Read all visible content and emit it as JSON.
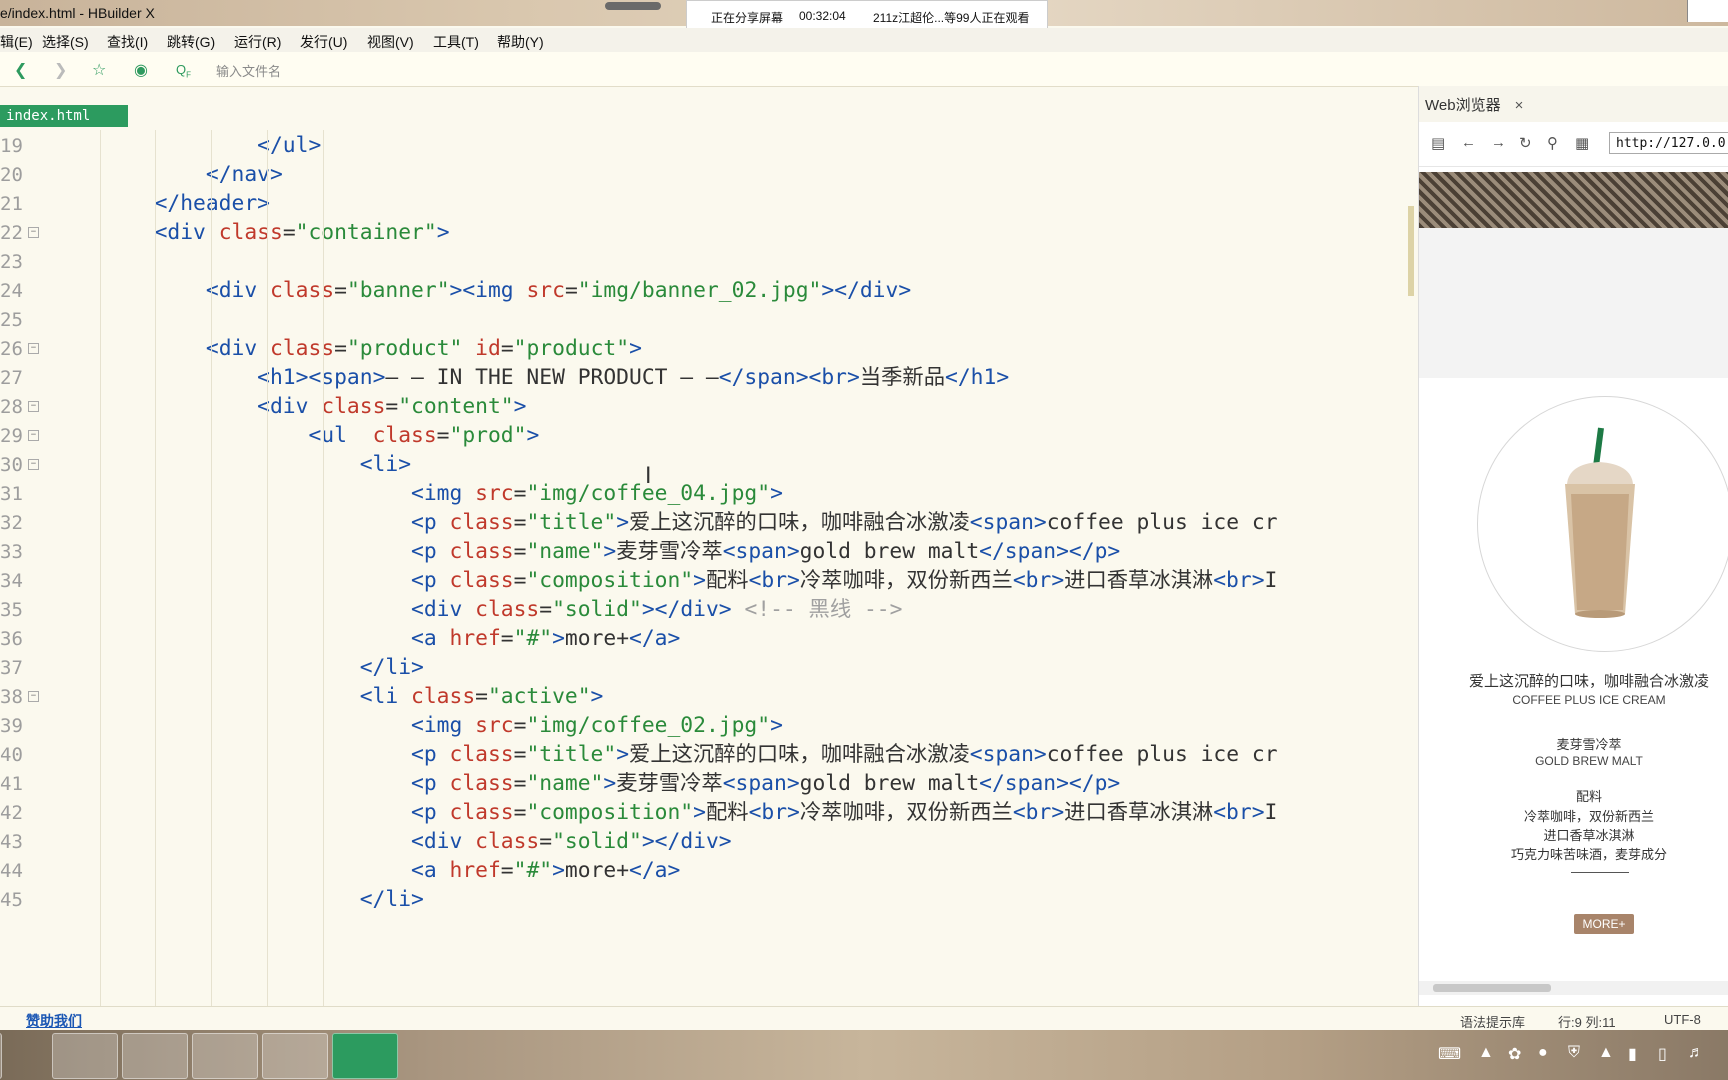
{
  "window": {
    "title": "e/index.html - HBuilder X"
  },
  "share_bar": {
    "status": "正在分享屏幕",
    "duration": "00:32:04",
    "viewers": "211z江超伦...等99人正在观看"
  },
  "menu": [
    "辑(E)",
    "选择(S)",
    "查找(I)",
    "跳转(G)",
    "运行(R)",
    "发行(U)",
    "视图(V)",
    "工具(T)",
    "帮助(Y)"
  ],
  "toolbar": {
    "file_search_placeholder": "输入文件名",
    "icons": [
      "back-icon",
      "forward-icon",
      "star-icon",
      "run-icon",
      "file-search-icon"
    ]
  },
  "editor": {
    "tab": "index.html",
    "lines": [
      {
        "n": "19",
        "code": "                </ul>"
      },
      {
        "n": "20",
        "code": "            </nav>"
      },
      {
        "n": "21",
        "code": "        </header>"
      },
      {
        "n": "22",
        "code": "        <div class=\"container\">",
        "fold": true
      },
      {
        "n": "23",
        "code": ""
      },
      {
        "n": "24",
        "code": "            <div class=\"banner\"><img src=\"img/banner_02.jpg\"></div>"
      },
      {
        "n": "25",
        "code": ""
      },
      {
        "n": "26",
        "code": "            <div class=\"product\" id=\"product\">",
        "fold": true
      },
      {
        "n": "27",
        "code": "                <h1><span>— — IN THE NEW PRODUCT — —</span><br>当季新品</h1>"
      },
      {
        "n": "28",
        "code": "                <div class=\"content\">",
        "fold": true
      },
      {
        "n": "29",
        "code": "                    <ul  class=\"prod\">",
        "fold": true
      },
      {
        "n": "30",
        "code": "                        <li>",
        "fold": true
      },
      {
        "n": "31",
        "code": "                            <img src=\"img/coffee_04.jpg\">"
      },
      {
        "n": "32",
        "code": "                            <p class=\"title\">爱上这沉醉的口味，咖啡融合冰激凌<span>coffee plus ice cr"
      },
      {
        "n": "33",
        "code": "                            <p class=\"name\">麦芽雪冷萃<span>gold brew malt</span></p>"
      },
      {
        "n": "34",
        "code": "                            <p class=\"composition\">配料<br>冷萃咖啡，双份新西兰<br>进口香草冰淇淋<br>I"
      },
      {
        "n": "35",
        "code": "                            <div class=\"solid\"></div> <!-- 黑线 -->"
      },
      {
        "n": "36",
        "code": "                            <a href=\"#\">more+</a>"
      },
      {
        "n": "37",
        "code": "                        </li>"
      },
      {
        "n": "38",
        "code": "                        <li class=\"active\">",
        "fold": true
      },
      {
        "n": "39",
        "code": "                            <img src=\"img/coffee_02.jpg\">"
      },
      {
        "n": "40",
        "code": "                            <p class=\"title\">爱上这沉醉的口味，咖啡融合冰激凌<span>coffee plus ice cr"
      },
      {
        "n": "41",
        "code": "                            <p class=\"name\">麦芽雪冷萃<span>gold brew malt</span></p>"
      },
      {
        "n": "42",
        "code": "                            <p class=\"composition\">配料<br>冷萃咖啡，双份新西兰<br>进口香草冰淇淋<br>I"
      },
      {
        "n": "43",
        "code": "                            <div class=\"solid\"></div>"
      },
      {
        "n": "44",
        "code": "                            <a href=\"#\">more+</a>"
      },
      {
        "n": "45",
        "code": "                        </li>"
      }
    ]
  },
  "browser": {
    "tab_label": "Web浏览器",
    "close": "×",
    "url": "http://127.0.0",
    "product": {
      "title": "爱上这沉醉的口味，咖啡融合冰激凌",
      "title_sub": "COFFEE PLUS ICE CREAM",
      "name": "麦芽雪冷萃",
      "name_sub": "GOLD BREW MALT",
      "composition_label": "配料",
      "composition_1": "冷萃咖啡，双份新西兰",
      "composition_2": "进口香草冰淇淋",
      "composition_3": "巧克力味苦味酒，麦芽成分",
      "more": "MORE+"
    }
  },
  "statusbar": {
    "sponsor": "赞助我们",
    "syntax": "语法提示库",
    "position": "行:9  列:11",
    "encoding": "UTF-8"
  },
  "colors": {
    "tab_green": "#2c9b5f",
    "tag": "#1a4fa8",
    "attr": "#c0392b",
    "string": "#2a8a3a",
    "comment": "#a0a0a0",
    "more_button": "#a8846a"
  }
}
